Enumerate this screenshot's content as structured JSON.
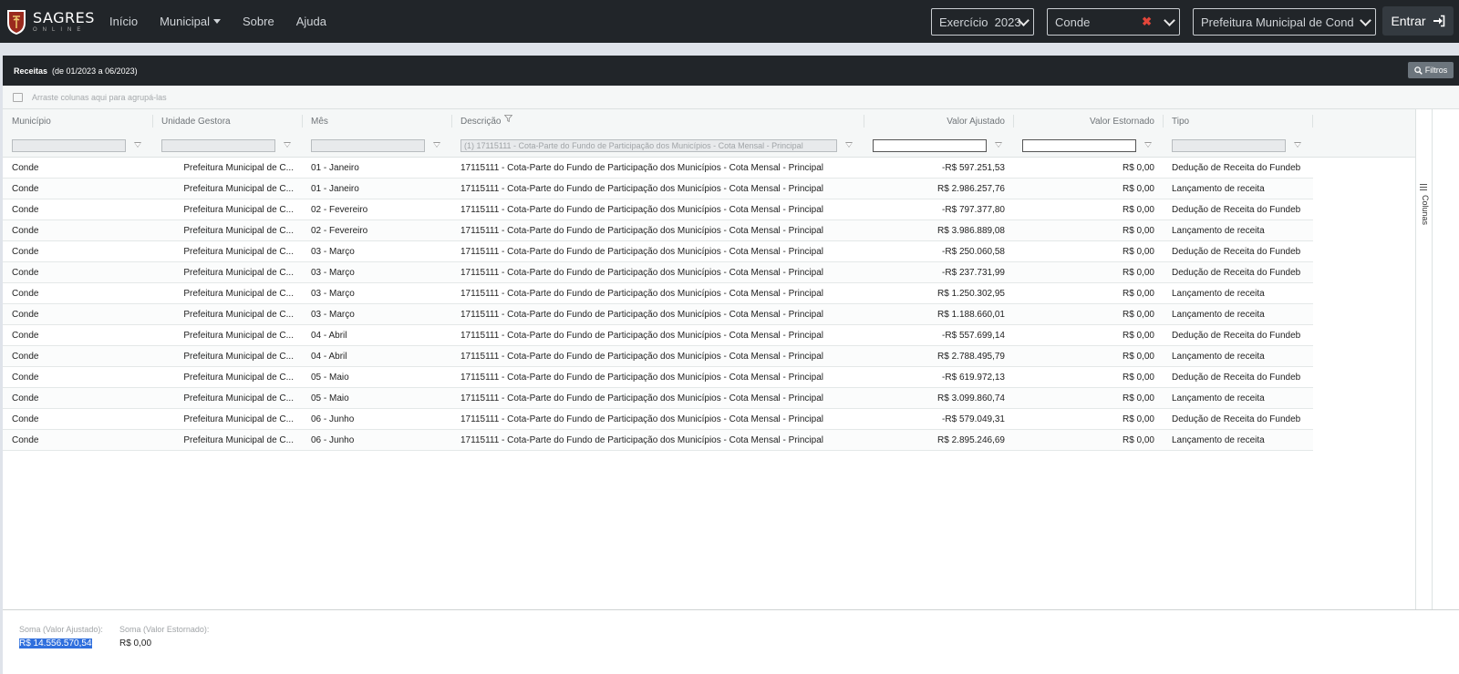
{
  "brand": {
    "name": "SAGRES",
    "tagline": "ONLINE"
  },
  "nav": {
    "links": [
      {
        "label": "Início",
        "dropdown": false
      },
      {
        "label": "Municipal",
        "dropdown": true
      },
      {
        "label": "Sobre",
        "dropdown": false
      },
      {
        "label": "Ajuda",
        "dropdown": false
      }
    ],
    "exercicio": "Exercício  2023",
    "municipio": "Conde",
    "orgao": "Prefeitura Municipal de Conde",
    "entrar": "Entrar"
  },
  "panel": {
    "title": "Receitas",
    "period": "(de 01/2023 a 06/2023)",
    "filtros": "Filtros",
    "group_hint": "Arraste colunas aqui para agrupá-las"
  },
  "columns": [
    "Município",
    "Unidade Gestora",
    "Mês",
    "Descrição",
    "Valor Ajustado",
    "Valor Estornado",
    "Tipo"
  ],
  "filters": {
    "descricao": "(1) 17115111 - Cota-Parte do Fundo de Participação dos Municípios - Cota Mensal - Principal"
  },
  "rows": [
    [
      "Conde",
      "Prefeitura Municipal de C...",
      "01 - Janeiro",
      "17115111 - Cota-Parte do Fundo de Participação dos Municípios - Cota Mensal - Principal",
      "-R$ 597.251,53",
      "R$ 0,00",
      "Dedução de Receita do Fundeb"
    ],
    [
      "Conde",
      "Prefeitura Municipal de C...",
      "01 - Janeiro",
      "17115111 - Cota-Parte do Fundo de Participação dos Municípios - Cota Mensal - Principal",
      "R$ 2.986.257,76",
      "R$ 0,00",
      "Lançamento de receita"
    ],
    [
      "Conde",
      "Prefeitura Municipal de C...",
      "02 - Fevereiro",
      "17115111 - Cota-Parte do Fundo de Participação dos Municípios - Cota Mensal - Principal",
      "-R$ 797.377,80",
      "R$ 0,00",
      "Dedução de Receita do Fundeb"
    ],
    [
      "Conde",
      "Prefeitura Municipal de C...",
      "02 - Fevereiro",
      "17115111 - Cota-Parte do Fundo de Participação dos Municípios - Cota Mensal - Principal",
      "R$ 3.986.889,08",
      "R$ 0,00",
      "Lançamento de receita"
    ],
    [
      "Conde",
      "Prefeitura Municipal de C...",
      "03 - Março",
      "17115111 - Cota-Parte do Fundo de Participação dos Municípios - Cota Mensal - Principal",
      "-R$ 250.060,58",
      "R$ 0,00",
      "Dedução de Receita do Fundeb"
    ],
    [
      "Conde",
      "Prefeitura Municipal de C...",
      "03 - Março",
      "17115111 - Cota-Parte do Fundo de Participação dos Municípios - Cota Mensal - Principal",
      "-R$ 237.731,99",
      "R$ 0,00",
      "Dedução de Receita do Fundeb"
    ],
    [
      "Conde",
      "Prefeitura Municipal de C...",
      "03 - Março",
      "17115111 - Cota-Parte do Fundo de Participação dos Municípios - Cota Mensal - Principal",
      "R$ 1.250.302,95",
      "R$ 0,00",
      "Lançamento de receita"
    ],
    [
      "Conde",
      "Prefeitura Municipal de C...",
      "03 - Março",
      "17115111 - Cota-Parte do Fundo de Participação dos Municípios - Cota Mensal - Principal",
      "R$ 1.188.660,01",
      "R$ 0,00",
      "Lançamento de receita"
    ],
    [
      "Conde",
      "Prefeitura Municipal de C...",
      "04 - Abril",
      "17115111 - Cota-Parte do Fundo de Participação dos Municípios - Cota Mensal - Principal",
      "-R$ 557.699,14",
      "R$ 0,00",
      "Dedução de Receita do Fundeb"
    ],
    [
      "Conde",
      "Prefeitura Municipal de C...",
      "04 - Abril",
      "17115111 - Cota-Parte do Fundo de Participação dos Municípios - Cota Mensal - Principal",
      "R$ 2.788.495,79",
      "R$ 0,00",
      "Lançamento de receita"
    ],
    [
      "Conde",
      "Prefeitura Municipal de C...",
      "05 - Maio",
      "17115111 - Cota-Parte do Fundo de Participação dos Municípios - Cota Mensal - Principal",
      "-R$ 619.972,13",
      "R$ 0,00",
      "Dedução de Receita do Fundeb"
    ],
    [
      "Conde",
      "Prefeitura Municipal de C...",
      "05 - Maio",
      "17115111 - Cota-Parte do Fundo de Participação dos Municípios - Cota Mensal - Principal",
      "R$ 3.099.860,74",
      "R$ 0,00",
      "Lançamento de receita"
    ],
    [
      "Conde",
      "Prefeitura Municipal de C...",
      "06 - Junho",
      "17115111 - Cota-Parte do Fundo de Participação dos Municípios - Cota Mensal - Principal",
      "-R$ 579.049,31",
      "R$ 0,00",
      "Dedução de Receita do Fundeb"
    ],
    [
      "Conde",
      "Prefeitura Municipal de C...",
      "06 - Junho",
      "17115111 - Cota-Parte do Fundo de Participação dos Municípios - Cota Mensal - Principal",
      "R$ 2.895.246,69",
      "R$ 0,00",
      "Lançamento de receita"
    ]
  ],
  "side_panel": {
    "label": "Colunas"
  },
  "footer": {
    "sum_ajustado_label": "Soma (Valor Ajustado):",
    "sum_ajustado": "R$ 14.556.570,54",
    "sum_estornado_label": "Soma (Valor Estornado):",
    "sum_estornado": "R$ 0,00"
  },
  "colors": {
    "navbar": "#212529",
    "accent_selection": "#2f6fdd",
    "clear_x": "#e2463a"
  }
}
